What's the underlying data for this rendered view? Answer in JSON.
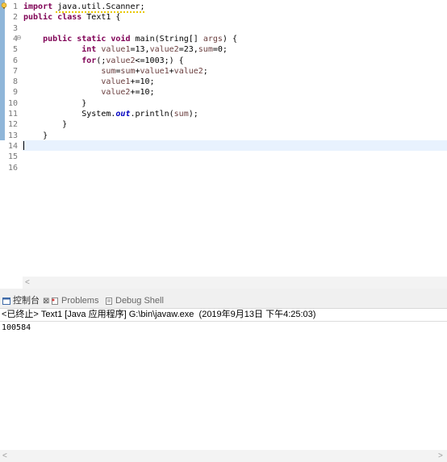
{
  "editor": {
    "line_numbers": [
      "1",
      "2",
      "3",
      "4",
      "5",
      "6",
      "7",
      "8",
      "9",
      "10",
      "11",
      "12",
      "13",
      "14",
      "15",
      "16"
    ],
    "code": {
      "l1_kw": "import",
      "l1_rest": " java.util.Scanner;",
      "l2_kw1": "public",
      "l2_sp": " ",
      "l2_kw2": "class",
      "l2_rest": " Text1 {",
      "l4_kw1": "public",
      "l4_kw2": "static",
      "l4_kw3": "void",
      "l4_rest": " main(String[] ",
      "l4_var": "args",
      "l4_end": ") {",
      "l5_kw": "int",
      "l5_v1": "value1",
      "l5_a": "=13,",
      "l5_v2": "value2",
      "l5_b": "=23,",
      "l5_v3": "sum",
      "l5_c": "=0;",
      "l6_kw": "for",
      "l6_a": "(;",
      "l6_v": "value2",
      "l6_b": "<=1003;) {",
      "l7_v1": "sum",
      "l7_a": "=",
      "l7_v2": "sum",
      "l7_b": "+",
      "l7_v3": "value1",
      "l7_c": "+",
      "l7_v4": "value2",
      "l7_d": ";",
      "l8_v": "value1",
      "l8_a": "+=10;",
      "l9_v": "value2",
      "l9_a": "+=10;",
      "l10": "}",
      "l11_a": "System.",
      "l11_fld": "out",
      "l11_b": ".println(",
      "l11_v": "sum",
      "l11_c": ");",
      "l12": "}",
      "l13": "}"
    }
  },
  "panel": {
    "tabs": [
      {
        "label": "控制台"
      },
      {
        "label": "Problems"
      },
      {
        "label": "Debug Shell"
      }
    ],
    "close_symbol": "⊠",
    "status": "<已终止> Text1 [Java 应用程序] G:\\bin\\javaw.exe  (2019年9月13日 下午4:25:03)",
    "output": "100584"
  },
  "icons": {
    "warning": "lightbulb-warning-icon",
    "fold": "collapse-fold-icon",
    "console": "console-icon",
    "problems": "problems-icon",
    "debug_shell": "debug-shell-icon"
  },
  "colors": {
    "keyword": "#7f0055",
    "variable": "#6a3e3e",
    "static_field": "#0000c0",
    "current_line": "#e8f2fe",
    "ruler": "#8fb6d9"
  }
}
